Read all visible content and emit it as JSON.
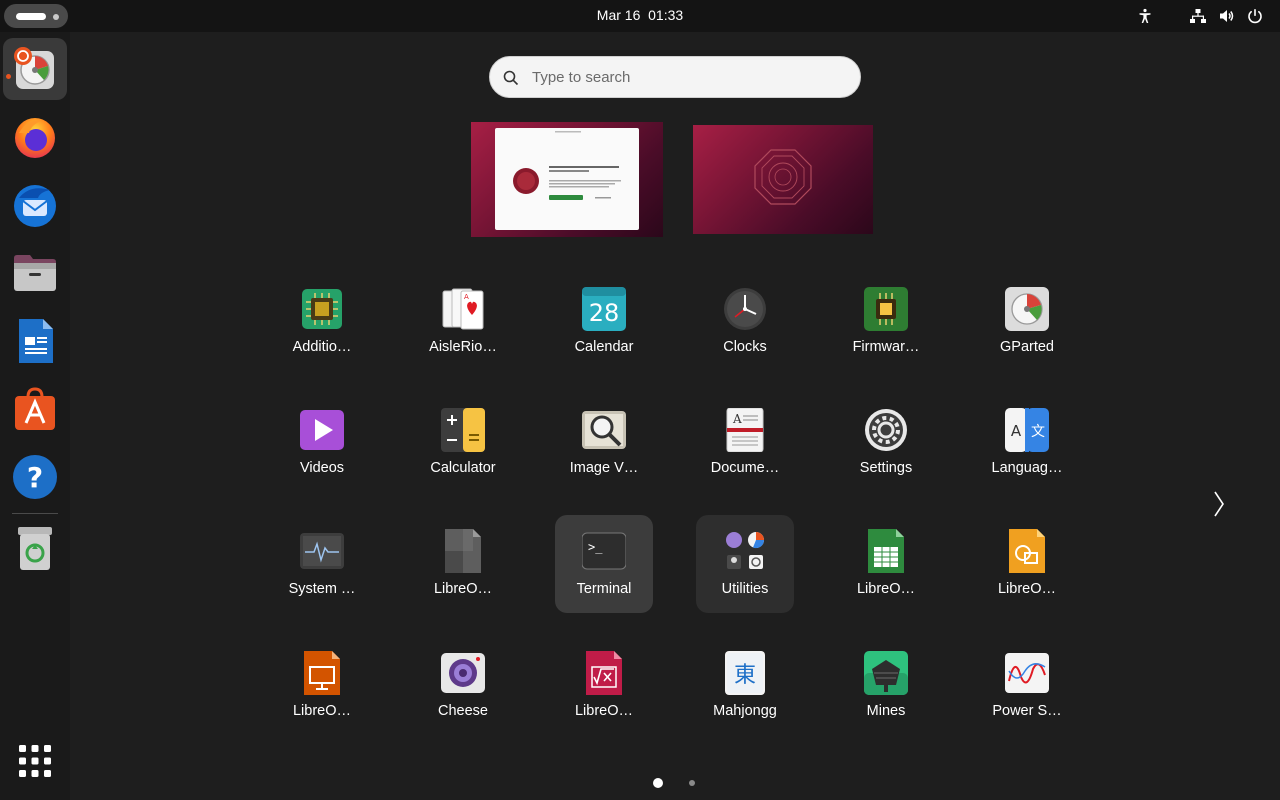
{
  "topbar": {
    "clock": "Mar 16  01:33",
    "icons": [
      "accessibility-icon",
      "network-icon",
      "volume-icon",
      "power-icon"
    ]
  },
  "dock": {
    "items": [
      {
        "name": "gparted",
        "icon": "gparted-icon",
        "active": true,
        "running": true
      },
      {
        "name": "firefox",
        "icon": "firefox-icon"
      },
      {
        "name": "thunderbird",
        "icon": "thunderbird-icon"
      },
      {
        "name": "files",
        "icon": "files-icon"
      },
      {
        "name": "libreoffice-writer",
        "icon": "writer-icon"
      },
      {
        "name": "app-center",
        "icon": "app-center-icon"
      },
      {
        "name": "help",
        "icon": "help-icon"
      },
      {
        "name": "trash",
        "icon": "trash-icon"
      },
      {
        "name": "show-apps",
        "icon": "grid-icon"
      }
    ]
  },
  "search": {
    "placeholder": "Type to search"
  },
  "apps": [
    {
      "label": "Additio…",
      "icon": "chip-icon"
    },
    {
      "label": "AisleRio…",
      "icon": "cards-icon"
    },
    {
      "label": "Calendar",
      "icon": "calendar-icon",
      "day": "28"
    },
    {
      "label": "Clocks",
      "icon": "clock-icon"
    },
    {
      "label": "Firmwar…",
      "icon": "firmware-icon"
    },
    {
      "label": "GParted",
      "icon": "gparted-icon"
    },
    {
      "label": "Videos",
      "icon": "videos-icon"
    },
    {
      "label": "Calculator",
      "icon": "calculator-icon"
    },
    {
      "label": "Image V…",
      "icon": "image-viewer-icon"
    },
    {
      "label": "Docume…",
      "icon": "document-viewer-icon"
    },
    {
      "label": "Settings",
      "icon": "settings-icon"
    },
    {
      "label": "Languag…",
      "icon": "language-icon"
    },
    {
      "label": "System …",
      "icon": "system-monitor-icon"
    },
    {
      "label": "LibreO…",
      "icon": "libreoffice-icon"
    },
    {
      "label": "Terminal",
      "icon": "terminal-icon"
    },
    {
      "label": "Utilities",
      "icon": "folder-utilities-icon"
    },
    {
      "label": "LibreO…",
      "icon": "calc-icon"
    },
    {
      "label": "LibreO…",
      "icon": "draw-icon"
    },
    {
      "label": "LibreO…",
      "icon": "impress-icon"
    },
    {
      "label": "Cheese",
      "icon": "cheese-icon"
    },
    {
      "label": "LibreO…",
      "icon": "math-icon"
    },
    {
      "label": "Mahjongg",
      "icon": "mahjongg-icon",
      "glyph": "東"
    },
    {
      "label": "Mines",
      "icon": "mines-icon"
    },
    {
      "label": "Power S…",
      "icon": "power-statistics-icon"
    }
  ],
  "pager": {
    "current": 1,
    "total": 2
  },
  "colors": {
    "accent": "#e95420",
    "panel": "#141414",
    "dock": "#1a1a1a",
    "overview": "#1e1e1e"
  }
}
